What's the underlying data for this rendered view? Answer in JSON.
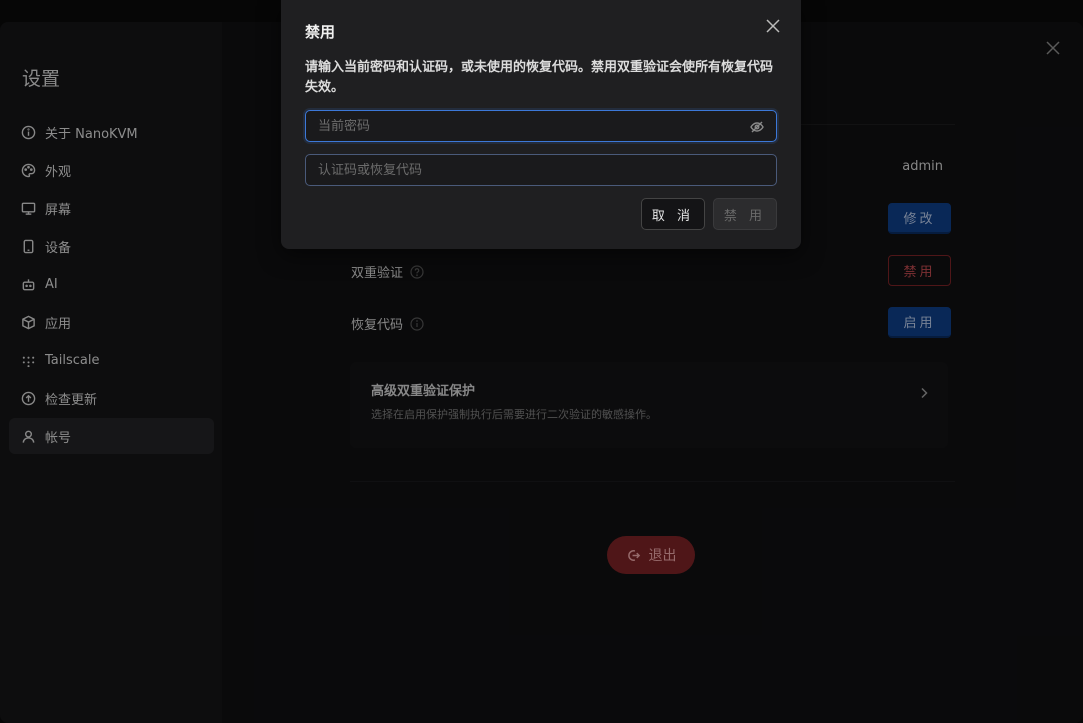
{
  "sidebar": {
    "title": "设置",
    "items": [
      {
        "label": "关于 NanoKVM",
        "icon": "info-icon"
      },
      {
        "label": "外观",
        "icon": "palette-icon"
      },
      {
        "label": "屏幕",
        "icon": "monitor-icon"
      },
      {
        "label": "设备",
        "icon": "device-icon"
      },
      {
        "label": "AI",
        "icon": "bot-icon"
      },
      {
        "label": "应用",
        "icon": "package-icon"
      },
      {
        "label": "Tailscale",
        "icon": "tailscale-icon"
      },
      {
        "label": "检查更新",
        "icon": "upload-circle-icon"
      },
      {
        "label": "帐号",
        "icon": "user-icon",
        "active": true
      }
    ]
  },
  "account": {
    "username": "admin",
    "password_button": "修改",
    "two_factor_label": "双重验证",
    "two_factor_button": "禁用",
    "recovery_label": "恢复代码",
    "recovery_button": "启用",
    "advanced_title": "高级双重验证保护",
    "advanced_desc": "选择在启用保护强制执行后需要进行二次验证的敏感操作。",
    "logout_label": "退出"
  },
  "modal": {
    "title": "禁用",
    "description": "请输入当前密码和认证码，或未使用的恢复代码。禁用双重验证会使所有恢复代码失效。",
    "password_placeholder": "当前密码",
    "code_placeholder": "认证码或恢复代码",
    "cancel_label": "取 消",
    "confirm_label": "禁 用"
  },
  "colors": {
    "accent_blue": "#0f3e86",
    "danger_red": "#7a2325",
    "focus_border": "#3c78d8"
  }
}
